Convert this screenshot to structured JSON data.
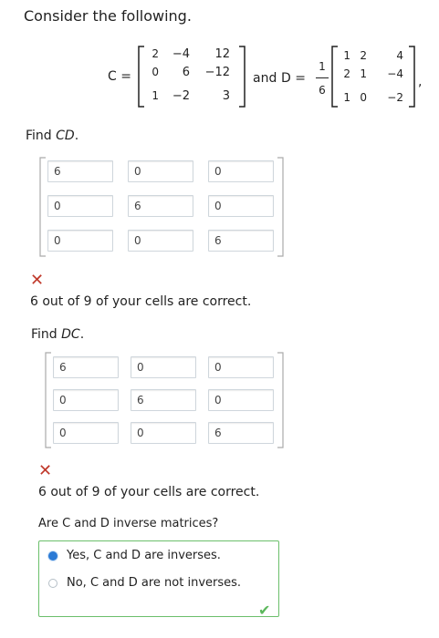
{
  "prompt": "Consider the following.",
  "matrix_c": {
    "label": "C =",
    "rows": [
      [
        "2",
        "−4",
        "12"
      ],
      [
        "0",
        "6",
        "−12"
      ],
      [
        "1",
        "−2",
        "3"
      ]
    ]
  },
  "and_text": "and",
  "matrix_d": {
    "label": "D =",
    "scalar_numerator": "1",
    "scalar_denominator": "6",
    "rows": [
      [
        "1",
        "2",
        "4"
      ],
      [
        "2",
        "1",
        "−4"
      ],
      [
        "1",
        "0",
        "−2"
      ]
    ],
    "trailing": ","
  },
  "find_cd": {
    "label_prefix": "Find ",
    "label_var": "CD",
    "label_suffix": ".",
    "cells": [
      [
        "6",
        "0",
        "0"
      ],
      [
        "0",
        "6",
        "0"
      ],
      [
        "0",
        "0",
        "6"
      ]
    ],
    "feedback": "6 out of 9 of your cells are correct."
  },
  "find_dc": {
    "label_prefix": "Find ",
    "label_var": "DC",
    "label_suffix": ".",
    "cells": [
      [
        "6",
        "0",
        "0"
      ],
      [
        "0",
        "6",
        "0"
      ],
      [
        "0",
        "0",
        "6"
      ]
    ],
    "feedback": "6 out of 9 of your cells are correct."
  },
  "inverse_question": {
    "text": "Are C and D inverse matrices?",
    "options": [
      {
        "label": "Yes, C and D are inverses.",
        "selected": true
      },
      {
        "label": "No, C and D are not inverses.",
        "selected": false
      }
    ]
  },
  "icons": {
    "incorrect": "x-mark-icon",
    "correct": "check-mark-icon"
  },
  "colors": {
    "incorrect": "#c0392b",
    "correct": "#5cb85c",
    "selected_radio": "#2a7ad5"
  }
}
